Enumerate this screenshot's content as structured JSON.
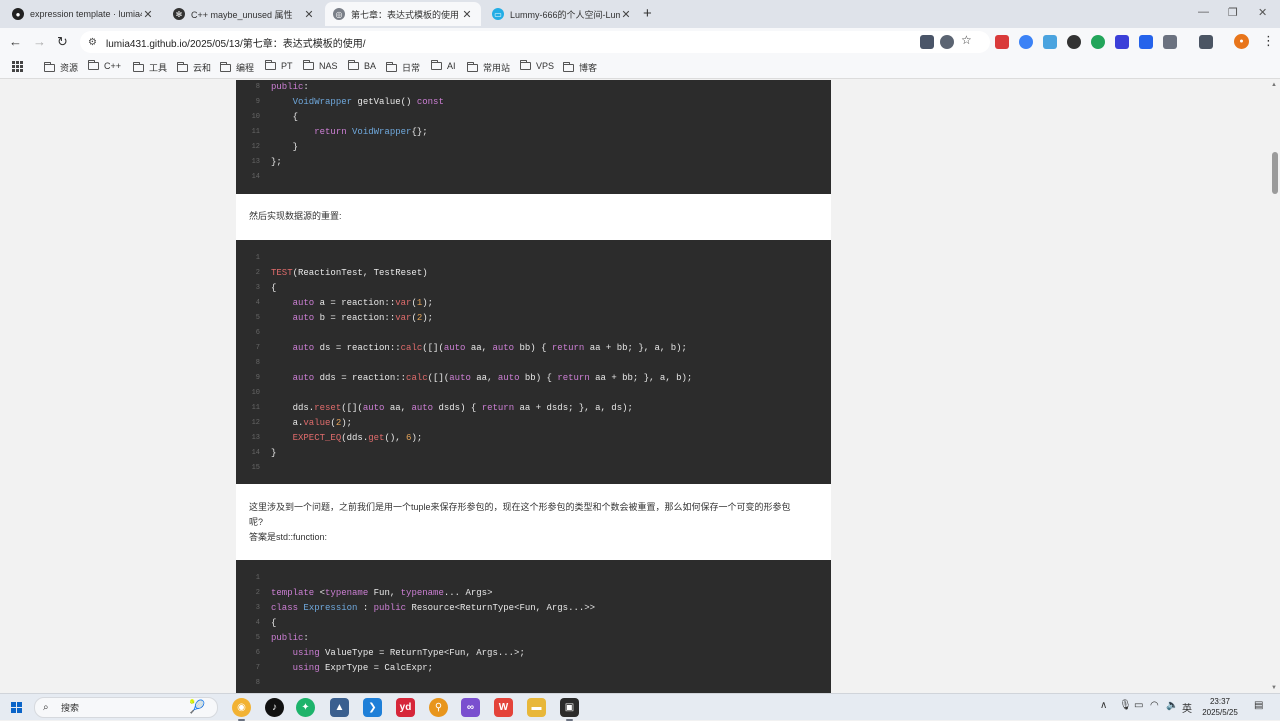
{
  "tabs": [
    {
      "title": "expression template · lumia4",
      "icon": "github"
    },
    {
      "title": "C++ maybe_unused 属性",
      "icon": "chatgpt"
    },
    {
      "title": "第七章：表达式模板的使用 | Lu",
      "icon": "web",
      "active": true
    },
    {
      "title": "Lummy-666的个人空间-Lumm",
      "icon": "bilibili"
    }
  ],
  "address": {
    "url": "lumia431.github.io/2025/05/13/第七章：表达式模板的使用/"
  },
  "bookmarks": [
    "资源",
    "C++",
    "工具",
    "云和",
    "编程",
    "PT",
    "NAS",
    "BA",
    "日常",
    "AI",
    "常用站",
    "VPS",
    "博客"
  ],
  "content": {
    "para1": "然后实现数据源的重置:",
    "para2_line1": "这里涉及到一个问题，之前我们是用一个tuple来保存形参包的，现在这个形参包的类型和个数会被重置，那么如何保存一个可变的形参包",
    "para2_line2": "呢?",
    "para3": "答案是std::function:",
    "code1": [
      {
        "n": "8",
        "t": "public:"
      },
      {
        "n": "9",
        "t": "    VoidWrapper getValue() const"
      },
      {
        "n": "10",
        "t": "    {"
      },
      {
        "n": "11",
        "t": "        return VoidWrapper{};"
      },
      {
        "n": "12",
        "t": "    }"
      },
      {
        "n": "13",
        "t": "};"
      },
      {
        "n": "14",
        "t": ""
      }
    ],
    "code2": [
      {
        "n": "1",
        "t": ""
      },
      {
        "n": "2",
        "t": "TEST(ReactionTest, TestReset)"
      },
      {
        "n": "3",
        "t": "{"
      },
      {
        "n": "4",
        "t": "    auto a = reaction::var(1);"
      },
      {
        "n": "5",
        "t": "    auto b = reaction::var(2);"
      },
      {
        "n": "6",
        "t": ""
      },
      {
        "n": "7",
        "t": "    auto ds = reaction::calc([](auto aa, auto bb) { return aa + bb; }, a, b);"
      },
      {
        "n": "8",
        "t": ""
      },
      {
        "n": "9",
        "t": "    auto dds = reaction::calc([](auto aa, auto bb) { return aa + bb; }, a, b);"
      },
      {
        "n": "10",
        "t": ""
      },
      {
        "n": "11",
        "t": "    dds.reset([](auto aa, auto dsds) { return aa + dsds; }, a, ds);"
      },
      {
        "n": "12",
        "t": "    a.value(2);"
      },
      {
        "n": "13",
        "t": "    EXPECT_EQ(dds.get(), 6);"
      },
      {
        "n": "14",
        "t": "}"
      },
      {
        "n": "15",
        "t": ""
      }
    ],
    "code3": [
      {
        "n": "1",
        "t": ""
      },
      {
        "n": "2",
        "t": "template <typename Fun, typename... Args>"
      },
      {
        "n": "3",
        "t": "class Expression : public Resource<ReturnType<Fun, Args...>>"
      },
      {
        "n": "4",
        "t": "{"
      },
      {
        "n": "5",
        "t": "public:"
      },
      {
        "n": "6",
        "t": "    using ValueType = ReturnType<Fun, Args...>;"
      },
      {
        "n": "7",
        "t": "    using ExprType = CalcExpr;"
      },
      {
        "n": "8",
        "t": ""
      }
    ]
  },
  "taskbar": {
    "search_placeholder": "搜索",
    "ime": "英",
    "time": "23:37",
    "date": "2025/5/25"
  },
  "colors": {
    "accent": "#0a64c8",
    "code_bg": "#2c2c2c",
    "keyword": "#cc7fd4",
    "type": "#6fa8dc",
    "func": "#e06c6c",
    "number": "#e5a45a"
  }
}
